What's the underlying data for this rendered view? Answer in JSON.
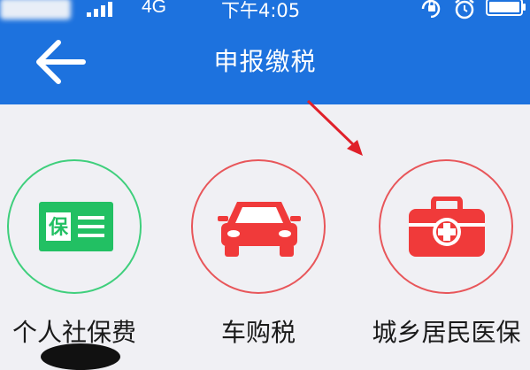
{
  "status_bar": {
    "network": "4G",
    "time": "下午4:05",
    "icons": [
      "signal-icon",
      "rotation-lock-icon",
      "alarm-icon",
      "battery-icon"
    ]
  },
  "header": {
    "title": "申报缴税",
    "back_icon": "back-arrow-icon",
    "background": "#1d72de"
  },
  "services": [
    {
      "label": "个人社保费",
      "icon": "social-insurance-card-icon",
      "ring_color": "#3fcf7c",
      "icon_text": "保"
    },
    {
      "label": "车购税",
      "icon": "car-icon",
      "ring_color": "#e8565a"
    },
    {
      "label": "城乡居民医保",
      "icon": "medical-kit-icon",
      "ring_color": "#e8565a"
    }
  ],
  "colors": {
    "accent_red": "#f03a3a",
    "accent_green": "#22c063"
  }
}
